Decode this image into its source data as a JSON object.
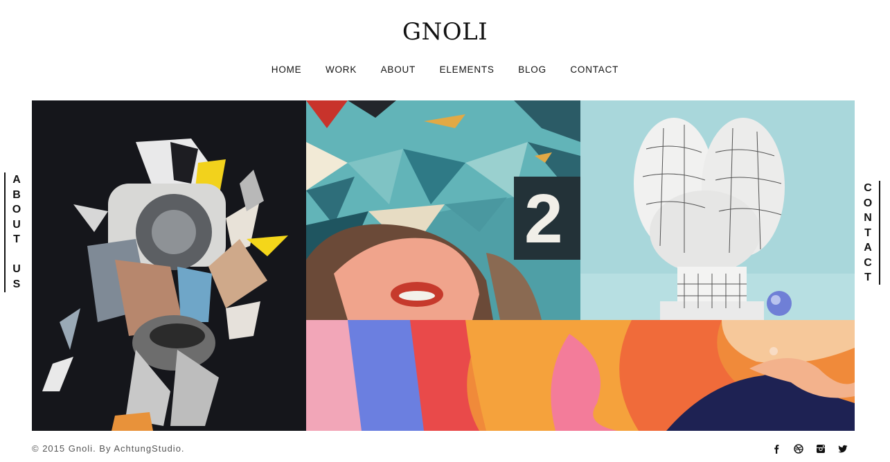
{
  "site": {
    "logo": "GNOLI"
  },
  "nav": {
    "items": [
      {
        "label": "HOME"
      },
      {
        "label": "WORK"
      },
      {
        "label": "ABOUT"
      },
      {
        "label": "ELEMENTS"
      },
      {
        "label": "BLOG"
      },
      {
        "label": "CONTACT"
      }
    ]
  },
  "side_tabs": {
    "left": {
      "label": "ABOUT US"
    },
    "right": {
      "label": "CONTACT"
    }
  },
  "footer": {
    "copyright": "© 2015 Gnoli. By AchtungStudio.",
    "social": [
      {
        "icon": "facebook-icon"
      },
      {
        "icon": "dribbble-icon"
      },
      {
        "icon": "instagram-icon"
      },
      {
        "icon": "twitter-icon"
      }
    ]
  },
  "colors": {
    "text": "#111111",
    "muted": "#555555",
    "background": "#ffffff"
  }
}
